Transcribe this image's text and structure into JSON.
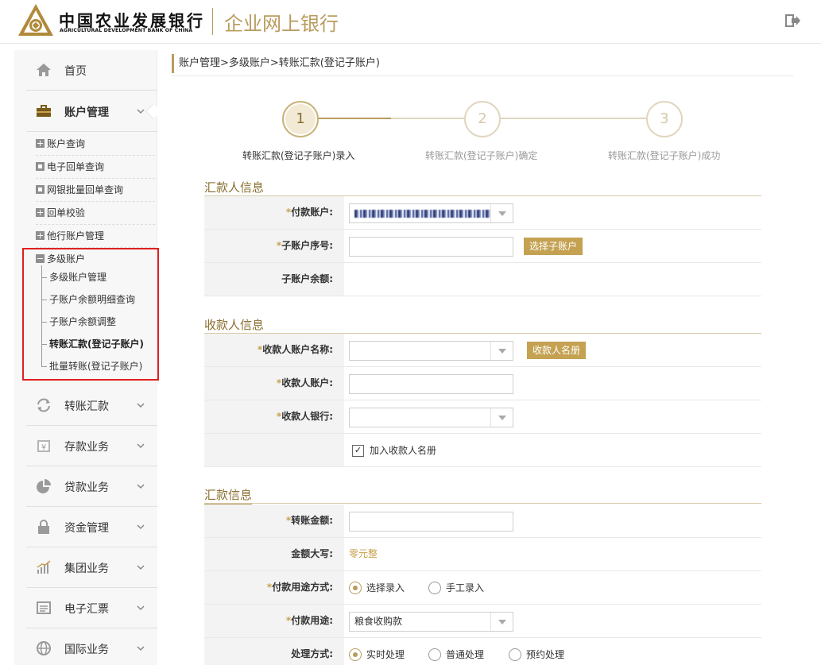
{
  "header": {
    "bank_name_cn": "中国农业发展银行",
    "bank_name_en": "AGRICULTURAL DEVELOPMENT BANK OF CHINA",
    "portal_title": "企业网上银行",
    "logout_icon": "logout-icon"
  },
  "colors": {
    "accent": "#b89c5e",
    "button": "#c4a252",
    "highlight_box": "#e02020"
  },
  "sidebar": {
    "home": "首页",
    "account_mgmt": "账户管理",
    "account_sub": [
      "账户查询",
      "电子回单查询",
      "网银批量回单查询",
      "回单校验",
      "他行账户管理",
      "多级账户"
    ],
    "multi_level_items": [
      "多级账户管理",
      "子账户余额明细查询",
      "子账户余额调整",
      "转账汇款(登记子账户)",
      "批量转账(登记子账户)"
    ],
    "transfer": "转账汇款",
    "deposit": "存款业务",
    "loan": "贷款业务",
    "fund": "资金管理",
    "group": "集团业务",
    "ebill": "电子汇票",
    "intl": "国际业务"
  },
  "breadcrumb": "账户管理>多级账户>转账汇款(登记子账户)",
  "steps": [
    {
      "num": "1",
      "label": "转账汇款(登记子账户)录入",
      "active": true
    },
    {
      "num": "2",
      "label": "转账汇款(登记子账户)确定",
      "active": false
    },
    {
      "num": "3",
      "label": "转账汇款(登记子账户)成功",
      "active": false
    }
  ],
  "payer": {
    "title": "汇款人信息",
    "pay_account_label": "付款账户:",
    "sub_account_no_label": "子账户序号:",
    "select_sub_account_btn": "选择子账户",
    "sub_account_balance_label": "子账户余额:",
    "sub_account_balance_value": ""
  },
  "payee": {
    "title": "收款人信息",
    "name_label": "收款人账户名称:",
    "payee_list_btn": "收款人名册",
    "account_label": "收款人账户:",
    "bank_label": "收款人银行:",
    "add_to_list_label": "加入收款人名册"
  },
  "remit": {
    "title": "汇款信息",
    "amount_label": "转账金额:",
    "amount_upper_label": "金额大写:",
    "amount_upper_value": "零元整",
    "purpose_mode_label": "付款用途方式:",
    "purpose_mode_options": [
      "选择录入",
      "手工录入"
    ],
    "purpose_label": "付款用途:",
    "purpose_value": "粮食收购款",
    "process_label": "处理方式:",
    "process_options": [
      "实时处理",
      "普通处理",
      "预约处理"
    ]
  }
}
